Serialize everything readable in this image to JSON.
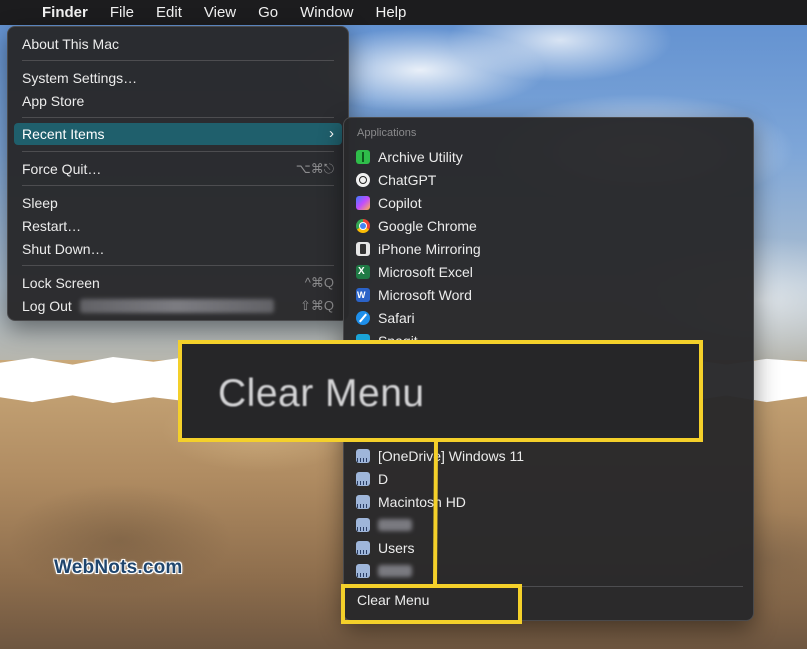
{
  "menubar": {
    "apple_glyph": "",
    "items": [
      "Finder",
      "File",
      "Edit",
      "View",
      "Go",
      "Window",
      "Help"
    ]
  },
  "apple_menu": {
    "about": "About This Mac",
    "system_settings": "System Settings…",
    "app_store": "App Store",
    "recent_items": "Recent Items",
    "recent_chevron": "›",
    "force_quit": "Force Quit…",
    "force_quit_shortcut": "⌥⌘⎋",
    "sleep": "Sleep",
    "restart": "Restart…",
    "shut_down": "Shut Down…",
    "lock_screen": "Lock Screen",
    "lock_screen_shortcut": "^⌘Q",
    "log_out": "Log Out",
    "log_out_shortcut": "⇧⌘Q"
  },
  "recent_menu": {
    "applications_header": "Applications",
    "applications": [
      {
        "label": "Archive Utility",
        "icon": "archive-utility-icon"
      },
      {
        "label": "ChatGPT",
        "icon": "chatgpt-icon"
      },
      {
        "label": "Copilot",
        "icon": "copilot-icon"
      },
      {
        "label": "Google Chrome",
        "icon": "chrome-icon"
      },
      {
        "label": "iPhone Mirroring",
        "icon": "iphone-mirroring-icon"
      },
      {
        "label": "Microsoft Excel",
        "icon": "excel-icon"
      },
      {
        "label": "Microsoft Word",
        "icon": "word-icon"
      },
      {
        "label": "Safari",
        "icon": "safari-icon"
      },
      {
        "label": "Snagit",
        "icon": "snagit-icon"
      }
    ],
    "servers": [
      {
        "label": "[OneDrive] Windows 11",
        "icon": "drive-icon"
      },
      {
        "label": "D",
        "icon": "drive-icon"
      },
      {
        "label": "Macintosh HD",
        "icon": "drive-icon"
      },
      {
        "label": "",
        "icon": "drive-icon"
      },
      {
        "label": "Users",
        "icon": "drive-icon"
      },
      {
        "label": "",
        "icon": "drive-icon"
      }
    ],
    "clear_menu": "Clear Menu"
  },
  "callout": {
    "zoom_text": "Clear Menu",
    "highlight_color": "#f4d02a"
  },
  "watermark": "WebNots.com",
  "colors": {
    "menu_highlight": "#1f5f6c",
    "menu_bg": "#28282a",
    "menubar_bg": "#1c1c1e"
  }
}
